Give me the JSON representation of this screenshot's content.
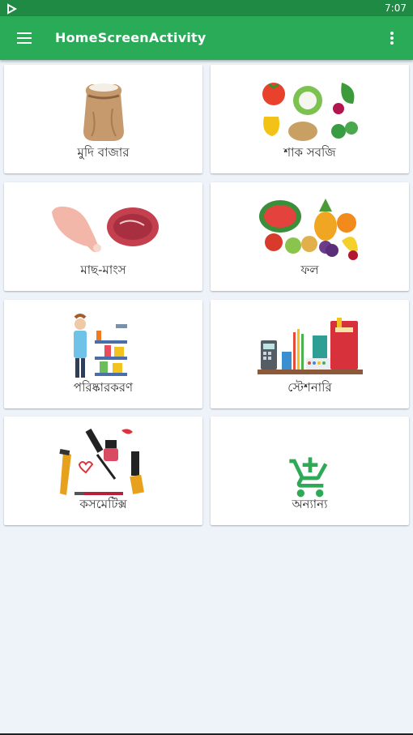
{
  "status_bar": {
    "time": "7:07"
  },
  "app_bar": {
    "title": "HomeScreenActivity"
  },
  "categories": [
    {
      "label": "মুদি বাজার",
      "icon": "grocery-sack-icon"
    },
    {
      "label": "শাক সবজি",
      "icon": "vegetables-icon"
    },
    {
      "label": "মাছ-মাংস",
      "icon": "meat-icon"
    },
    {
      "label": "ফল",
      "icon": "fruits-icon"
    },
    {
      "label": "পরিষ্কারকরণ",
      "icon": "cleaning-icon"
    },
    {
      "label": "স্টেশনারি",
      "icon": "stationery-icon"
    },
    {
      "label": "কসমেটিক্স",
      "icon": "cosmetics-icon"
    },
    {
      "label": "অন্যান্য",
      "icon": "add-to-cart-icon"
    }
  ],
  "colors": {
    "primary": "#29ab58",
    "status_bar": "#1f8a43",
    "background": "#eef3fa",
    "accent_cart": "#2eaa57"
  }
}
